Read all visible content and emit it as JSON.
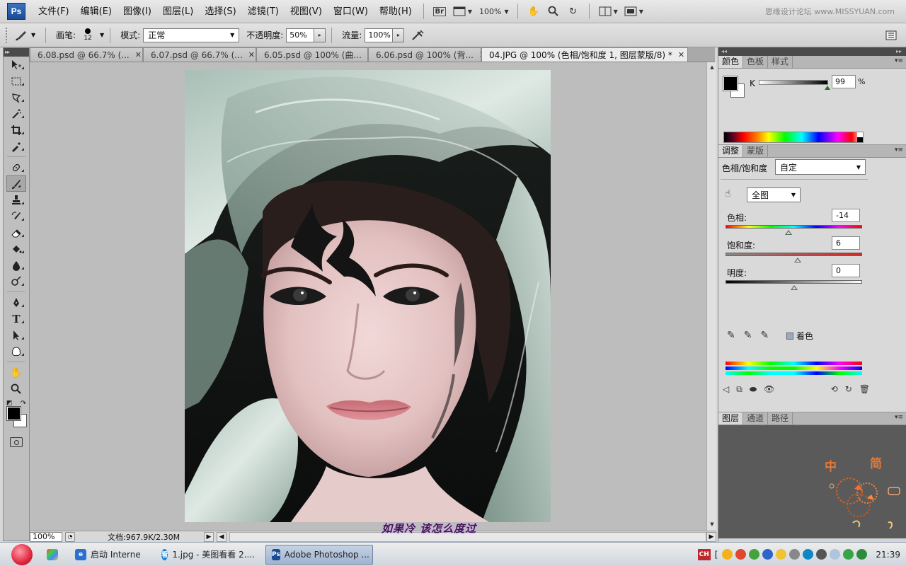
{
  "menubar": {
    "app_logo": "Ps",
    "items": [
      "文件(F)",
      "编辑(E)",
      "图像(I)",
      "图层(L)",
      "选择(S)",
      "滤镜(T)",
      "视图(V)",
      "窗口(W)",
      "帮助(H)"
    ],
    "bridge_label": "Br",
    "zoom_level": "100%",
    "watermark": "思缘设计论坛 www.MISSYUAN.com"
  },
  "options": {
    "brush_label": "画笔:",
    "brush_size": "12",
    "mode_label": "模式:",
    "mode_value": "正常",
    "opacity_label": "不透明度:",
    "opacity_value": "50%",
    "flow_label": "流量:",
    "flow_value": "100%"
  },
  "doc_tabs": [
    {
      "label": "6.08.psd @ 66.7% (..."
    },
    {
      "label": "6.07.psd @ 66.7% (..."
    },
    {
      "label": "6.05.psd @ 100% (曲..."
    },
    {
      "label": "6.06.psd @ 100% (背..."
    },
    {
      "label": "04.JPG @ 100% (色相/饱和度 1, 图层蒙版/8) *"
    }
  ],
  "status": {
    "zoom": "100%",
    "doc_info": "文档:967.9K/2.30M",
    "subtitle": "如果冷 该怎么度过"
  },
  "color_panel": {
    "tabs": [
      "颜色",
      "色板",
      "样式"
    ],
    "channel_label": "K",
    "k_value": "99",
    "k_fraction": 0.99,
    "percent": "%"
  },
  "adjust_panel": {
    "tabs": [
      "调整",
      "蒙版"
    ],
    "title": "色相/饱和度",
    "preset": "自定",
    "channel": "全图",
    "hue_label": "色相:",
    "hue_value": "-14",
    "saturation_label": "饱和度:",
    "saturation_value": "6",
    "lightness_label": "明度:",
    "lightness_value": "0",
    "colorize_label": "着色"
  },
  "layers_panel": {
    "tabs": [
      "图层",
      "通道",
      "路径"
    ],
    "deco_chars": [
      "中",
      "简"
    ]
  },
  "taskbar": {
    "items": [
      {
        "label": "启动 Interne",
        "icon": "ie-icon"
      },
      {
        "label": "1.jpg - 美图看看 2....",
        "icon": "viewer-icon"
      },
      {
        "label": "Adobe Photoshop ...",
        "icon": "photoshop-icon"
      }
    ],
    "ime": "CH",
    "clock": "21:39"
  },
  "colors": {
    "ps_blue": "#1b4b93",
    "panel_gray": "#d4d4d4",
    "canvas_gray": "#bdbdbd"
  }
}
